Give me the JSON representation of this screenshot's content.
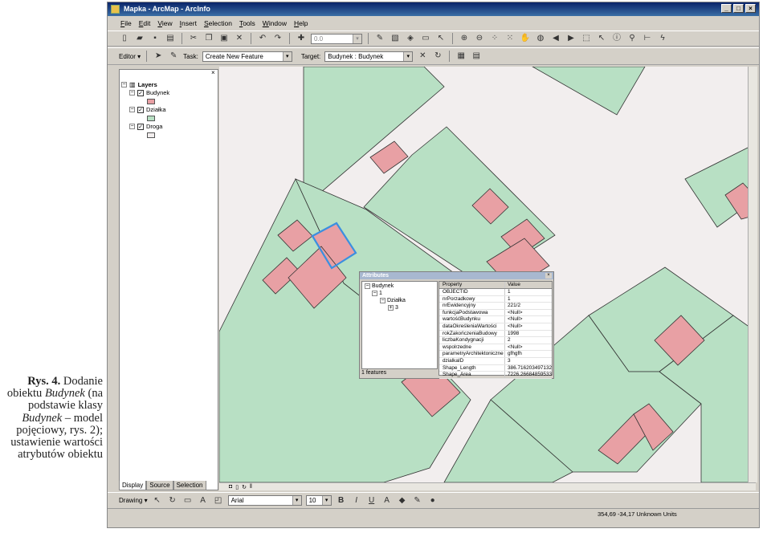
{
  "caption": {
    "label": "Rys. 4.",
    "text_parts": [
      {
        "t": " Dodanie obiektu ",
        "i": false
      },
      {
        "t": "Budynek",
        "i": true
      },
      {
        "t": " (na podstawie klasy ",
        "i": false
      },
      {
        "t": "Budynek",
        "i": true
      },
      {
        "t": " – model pojęciowy, rys. 2); ustawienie wartości atrybutów obiektu",
        "i": false
      }
    ]
  },
  "window": {
    "title": "Mapka - ArcMap - ArcInfo",
    "controls": [
      "_",
      "□",
      "×"
    ]
  },
  "menu": [
    "File",
    "Edit",
    "View",
    "Insert",
    "Selection",
    "Tools",
    "Window",
    "Help"
  ],
  "toolbar": {
    "scale_value": "0.0",
    "editor_label": "Editor ▾",
    "task_label": "Task:",
    "task_value": "Create New Feature",
    "target_label": "Target:",
    "target_value": "Budynek : Budynek"
  },
  "toc": {
    "root": "Layers",
    "layers": [
      {
        "name": "Budynek",
        "color": "#e8a0a4"
      },
      {
        "name": "Działka",
        "color": "#b8e0c4"
      },
      {
        "name": "Droga",
        "color": "#f2eeee"
      }
    ],
    "tabs": [
      "Display",
      "Source",
      "Selection"
    ]
  },
  "attributes_window": {
    "title": "Attributes",
    "tree": [
      "Budynek",
      "1",
      "Działka",
      "3"
    ],
    "features_label": "1 features",
    "headers": [
      "Property",
      "Value"
    ],
    "rows": [
      [
        "OBJECTID",
        "1"
      ],
      [
        "nrPorzadkowy",
        "1"
      ],
      [
        "nrEwidencyjny",
        "221/2"
      ],
      [
        "funkcjaPodstawowa",
        "<Null>"
      ],
      [
        "wartośćBudynku",
        "<Null>"
      ],
      [
        "dataOkreśleniaWartości",
        "<Null>"
      ],
      [
        "rokZakończeniaBudowy",
        "1998"
      ],
      [
        "liczbaKondygnacji",
        "2"
      ],
      [
        "wspolrzedne",
        "<Null>"
      ],
      [
        "parametryArchitektoniczne",
        "gfhgfh"
      ],
      [
        "dzialkaID",
        "3"
      ],
      [
        "Shape_Length",
        "386.716203497132"
      ],
      [
        "Shape_Area",
        "7226.26684859533"
      ]
    ]
  },
  "drawing_toolbar": {
    "drawing_label": "Drawing ▾",
    "font_value": "Arial",
    "font_size": "10"
  },
  "status": {
    "coordinates": "354,69  -34,17 Unknown Units"
  },
  "map_colors": {
    "parcel": "#b8e0c4",
    "building": "#e8a0a4",
    "road": "#f2eeee",
    "selection": "#3b8fe0"
  }
}
